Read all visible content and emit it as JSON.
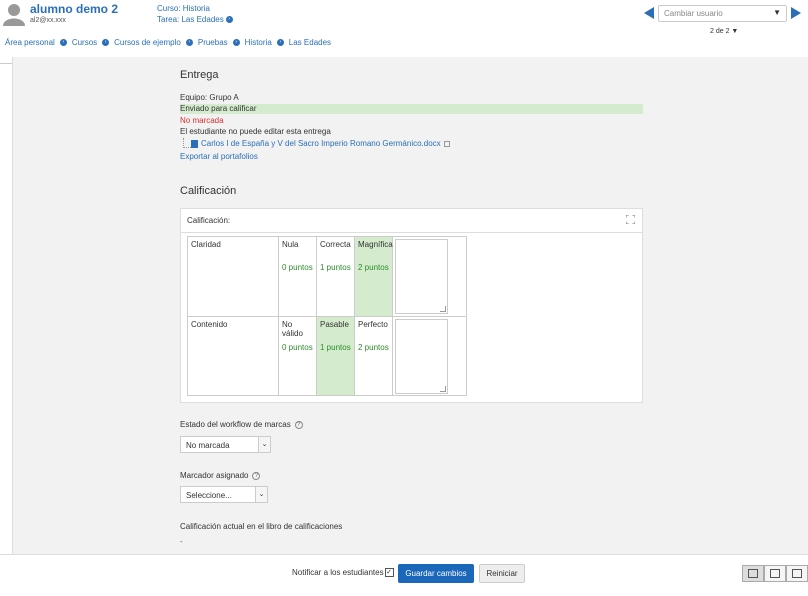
{
  "header": {
    "user_name": "alumno demo 2",
    "user_email": "al2@xx.xxx",
    "course_line": "Curso: Historia",
    "task_line": "Tarea: Las Edades",
    "change_user_placeholder": "Cambiar usuario",
    "pager": "2 de 2",
    "accent": "#2a6fb8"
  },
  "breadcrumb": [
    "Área personal",
    "Cursos",
    "Cursos de ejemplo",
    "Pruebas",
    "Historia",
    "Las Edades"
  ],
  "submission": {
    "title": "Entrega",
    "team": "Equipo: Grupo A",
    "status": "Enviado para calificar",
    "grading_status": "No marcada",
    "edit_status": "El estudiante no puede editar esta entrega",
    "file_name": "Carlos I de España y V del Sacro Imperio Romano Germánico.docx",
    "export_link": "Exportar al portafolios"
  },
  "grading": {
    "title": "Calificación",
    "box_label": "Calificación:",
    "rubric": [
      {
        "criterion": "Claridad",
        "levels": [
          {
            "label": "Nula",
            "points": "0  puntos",
            "selected": false
          },
          {
            "label": "Correcta",
            "points": "1  puntos",
            "selected": false
          },
          {
            "label": "Magnífica",
            "points": "2  puntos",
            "selected": true
          }
        ]
      },
      {
        "criterion": "Contenido",
        "levels": [
          {
            "label": "No válido",
            "points": "0  puntos",
            "selected": false
          },
          {
            "label": "Pasable",
            "points": "1  puntos",
            "selected": true
          },
          {
            "label": "Perfecto",
            "points": "2  puntos",
            "selected": false
          }
        ]
      }
    ]
  },
  "workflow": {
    "label": "Estado del workflow de marcas",
    "value": "No marcada"
  },
  "marker": {
    "label": "Marcador asignado",
    "value": "Seleccione..."
  },
  "gradebook": {
    "label": "Calificación actual en el libro de calificaciones",
    "value": "-"
  },
  "footer": {
    "notify_label": "Notificar a los estudiantes",
    "notify_checked": "✓",
    "save_label": "Guardar cambios",
    "reset_label": "Reiniciar"
  }
}
